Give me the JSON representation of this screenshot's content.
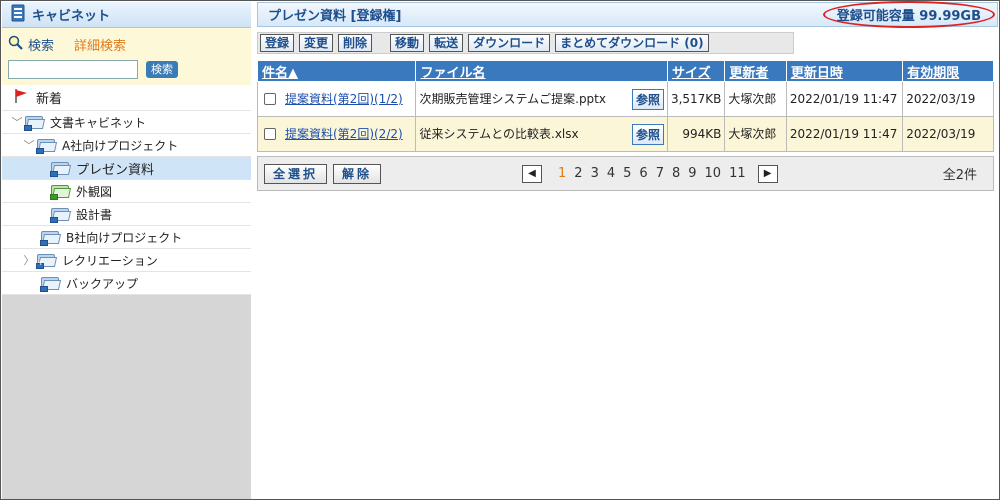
{
  "sidebar": {
    "title": "キャビネット",
    "search_label": "検索",
    "advanced_search_label": "詳細検索",
    "search_placeholder": "",
    "search_button": "検索",
    "new_label": "新着",
    "tree": [
      {
        "label": "文書キャビネット",
        "level": 0,
        "expanded": true
      },
      {
        "label": "A社向けプロジェクト",
        "level": 1,
        "expanded": true
      },
      {
        "label": "プレゼン資料",
        "level": 2,
        "selected": true
      },
      {
        "label": "外観図",
        "level": 2,
        "green": true
      },
      {
        "label": "設計書",
        "level": 2
      },
      {
        "label": "B社向けプロジェクト",
        "level": 1
      },
      {
        "label": "レクリエーション",
        "level": 1,
        "collapsed": true
      },
      {
        "label": "バックアップ",
        "level": 1
      }
    ]
  },
  "header": {
    "title": "プレゼン資料 [登録権]",
    "capacity": "登録可能容量 99.99GB"
  },
  "toolbar": {
    "register": "登録",
    "modify": "変更",
    "delete": "削除",
    "move": "移動",
    "transfer": "転送",
    "download": "ダウンロード",
    "bulk_download": "まとめてダウンロード (0)"
  },
  "table": {
    "headers": {
      "subject": "件名▲",
      "filename": "ファイル名",
      "size": "サイズ",
      "updater": "更新者",
      "updated": "更新日時",
      "expiry": "有効期限"
    },
    "ref_label": "参照",
    "rows": [
      {
        "subject": "提案資料(第2回)(1/2)",
        "filename": "次期販売管理システムご提案.pptx",
        "size": "3,517KB",
        "updater": "大塚次郎",
        "updated": "2022/01/19 11:47",
        "expiry": "2022/03/19"
      },
      {
        "subject": "提案資料(第2回)(2/2)",
        "filename": "従来システムとの比較表.xlsx",
        "size": "994KB",
        "updater": "大塚次郎",
        "updated": "2022/01/19 11:47",
        "expiry": "2022/03/19"
      }
    ]
  },
  "pager": {
    "select_all": "全選択",
    "clear": "解除",
    "pages": [
      "1",
      "2",
      "3",
      "4",
      "5",
      "6",
      "7",
      "8",
      "9",
      "10",
      "11"
    ],
    "current": "1",
    "total": "全2件"
  }
}
